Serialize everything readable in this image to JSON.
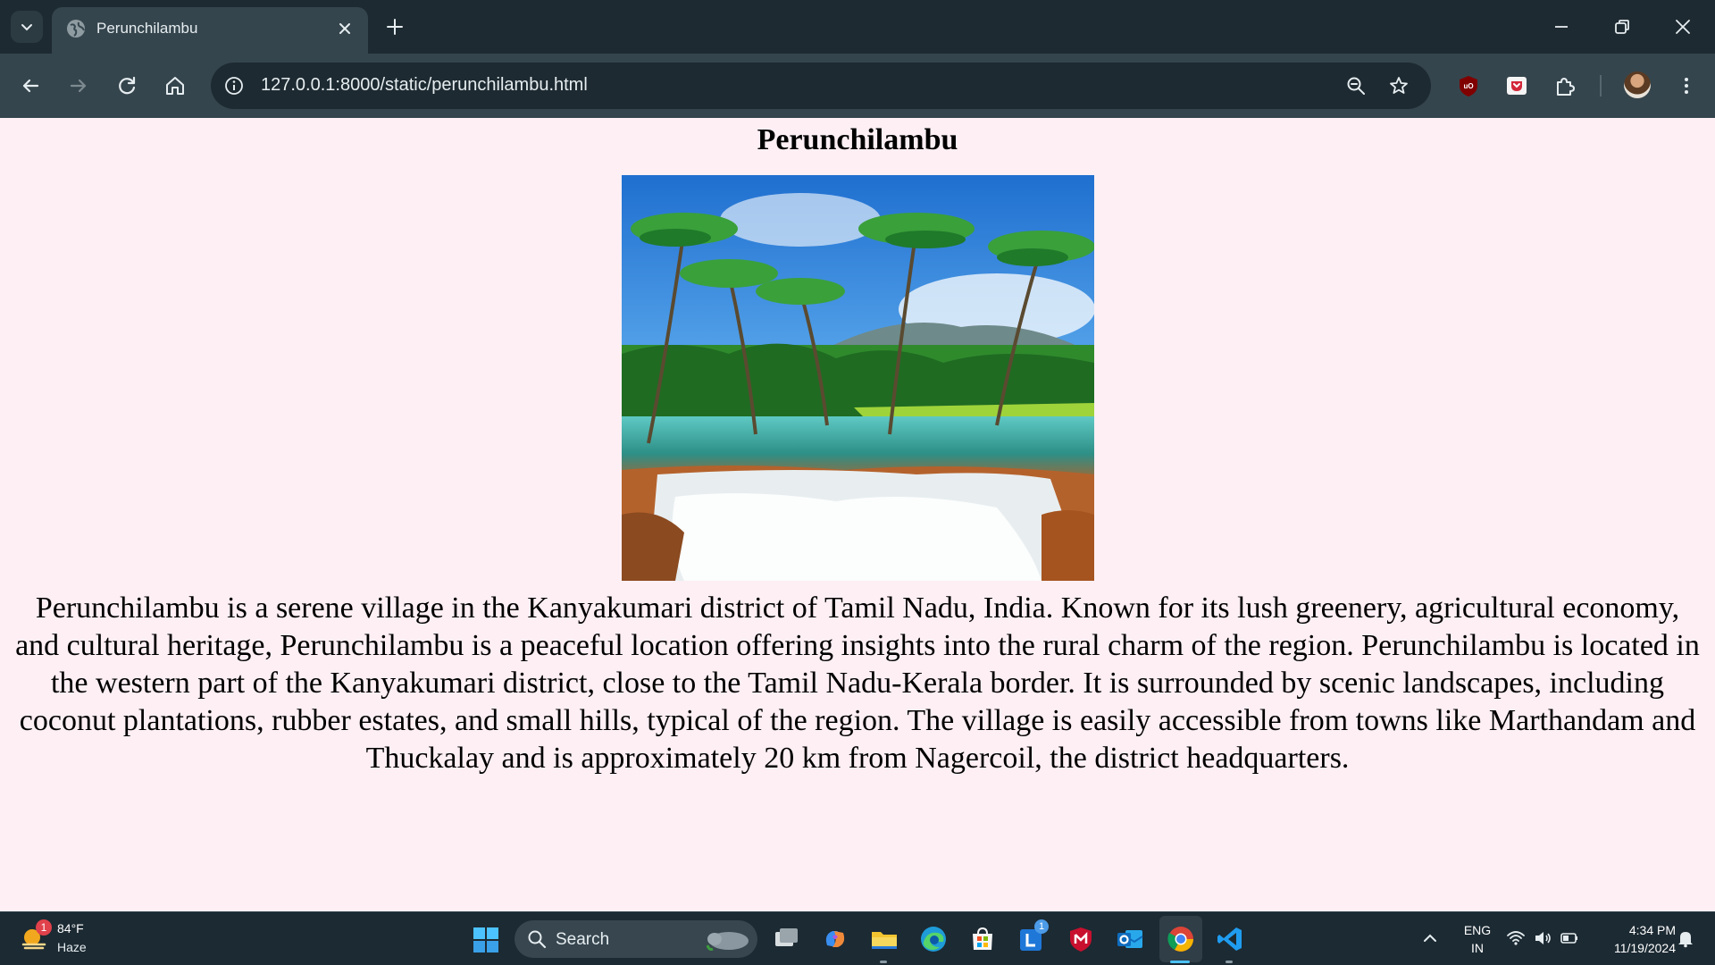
{
  "browser": {
    "tab": {
      "title": "Perunchilambu"
    },
    "address_bar": {
      "url": "127.0.0.1:8000/static/perunchilambu.html"
    }
  },
  "page": {
    "title": "Perunchilambu",
    "paragraph": "Perunchilambu is a serene village in the Kanyakumari district of Tamil Nadu, India. Known for its lush greenery, agricultural economy, and cultural heritage, Perunchilambu is a peaceful location offering insights into the rural charm of the region. Perunchilambu is located in the western part of the Kanyakumari district, close to the Tamil Nadu-Kerala border. It is surrounded by scenic landscapes, including coconut plantations, rubber estates, and small hills, typical of the region. The village is easily accessible from towns like Marthandam and Thuckalay and is approximately 20 km from Nagercoil, the district headquarters."
  },
  "taskbar": {
    "weather": {
      "temperature": "84°F",
      "condition": "Haze",
      "badge": "1"
    },
    "search": {
      "label": "Search"
    },
    "apps": [
      {
        "name": "task-view-icon"
      },
      {
        "name": "copilot-icon"
      },
      {
        "name": "file-explorer-icon"
      },
      {
        "name": "edge-icon"
      },
      {
        "name": "microsoft-store-icon"
      },
      {
        "name": "lync-icon",
        "badge": "1"
      },
      {
        "name": "mcafee-icon"
      },
      {
        "name": "outlook-icon"
      },
      {
        "name": "chrome-icon"
      },
      {
        "name": "vscode-icon"
      }
    ],
    "tray": {
      "language": "ENG",
      "region": "IN",
      "time": "4:34 PM",
      "date": "11/19/2024"
    }
  },
  "colors": {
    "page_background": "#fdeff4",
    "tabbar": "#1d2a31",
    "toolbar": "#35454d",
    "taskbar": "#1c2a33"
  }
}
